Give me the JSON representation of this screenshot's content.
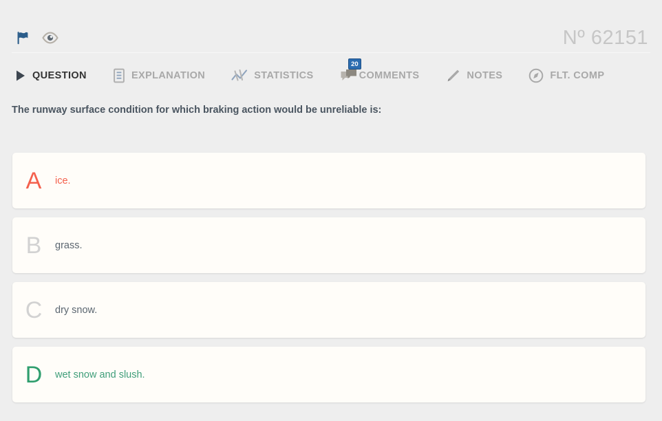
{
  "header": {
    "flag_icon": "flag-icon",
    "eye_icon": "eye-icon",
    "question_number": "Nº 62151"
  },
  "tabs": [
    {
      "id": "question",
      "label": "QUESTION",
      "icon": "play-triangle-icon",
      "active": true,
      "badge": null
    },
    {
      "id": "explanation",
      "label": "EXPLANATION",
      "icon": "document-lines-icon",
      "active": false,
      "badge": null
    },
    {
      "id": "statistics",
      "label": "STATISTICS",
      "icon": "line-chart-icon",
      "active": false,
      "badge": null
    },
    {
      "id": "comments",
      "label": "COMMENTS",
      "icon": "speech-bubbles-icon",
      "active": false,
      "badge": "20"
    },
    {
      "id": "notes",
      "label": "NOTES",
      "icon": "pencil-icon",
      "active": false,
      "badge": null
    },
    {
      "id": "flt-comp",
      "label": "FLT. COMP",
      "icon": "compass-icon",
      "active": false,
      "badge": null
    }
  ],
  "question": {
    "text": "The runway surface condition for which braking action would be unreliable is:"
  },
  "options": [
    {
      "letter": "A",
      "text": "ice.",
      "state": "incorrect"
    },
    {
      "letter": "B",
      "text": "grass.",
      "state": "neutral"
    },
    {
      "letter": "C",
      "text": "dry snow.",
      "state": "neutral"
    },
    {
      "letter": "D",
      "text": "wet snow and slush.",
      "state": "correct"
    }
  ],
  "colors": {
    "page_background": "#eeeeee",
    "card_background": "#fffdf9",
    "active_tab": "#333333",
    "inactive_tab": "#a8a8a8",
    "badge": "#2b6cb0",
    "incorrect": "#f4604d",
    "correct": "#2f9e6e",
    "neutral_letter": "#d2d2d2",
    "question_number": "#c6c6c6",
    "flag": "#2b5d8a"
  }
}
